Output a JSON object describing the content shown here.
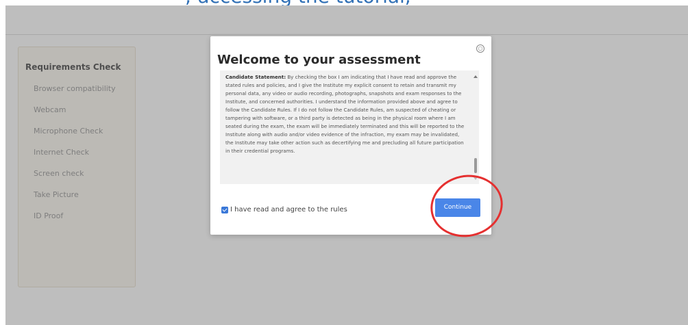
{
  "caption": {
    "text": "; accessing the tutorial; "
  },
  "sidebar": {
    "title": "Requirements Check",
    "items": [
      {
        "label": "Browser compatibility"
      },
      {
        "label": "Webcam"
      },
      {
        "label": "Microphone Check"
      },
      {
        "label": "Internet Check"
      },
      {
        "label": "Screen check"
      },
      {
        "label": "Take Picture"
      },
      {
        "label": "ID Proof"
      }
    ]
  },
  "modal": {
    "title": "Welcome to your assessment",
    "statement_heading": "Candidate Statement:",
    "statement_body": " By checking the box I am indicating that I have read and approve the stated rules and policies, and I give the Institute my explicit consent to retain and transmit my personal data, any video or audio recording, photographs, snapshots and exam responses to the Institute, and concerned authorities. I understand the information provided above and agree to follow the Candidate Rules. If I do not follow the Candidate Rules, am suspected of cheating or tampering with software, or a third party is detected as being in the physical room where I am seated during the exam, the exam will be immediately terminated and this will be reported to the Institute along with audio and/or video evidence of the infraction, my exam may be invalidated, the Institute may take other action such as decertifying me and precluding all future participation in their credential programs.",
    "agree_label": "I have read and agree to the rules",
    "agree_checked": true,
    "continue_label": "Continue"
  },
  "colors": {
    "accent": "#4a86e8",
    "highlight": "#e53030"
  }
}
